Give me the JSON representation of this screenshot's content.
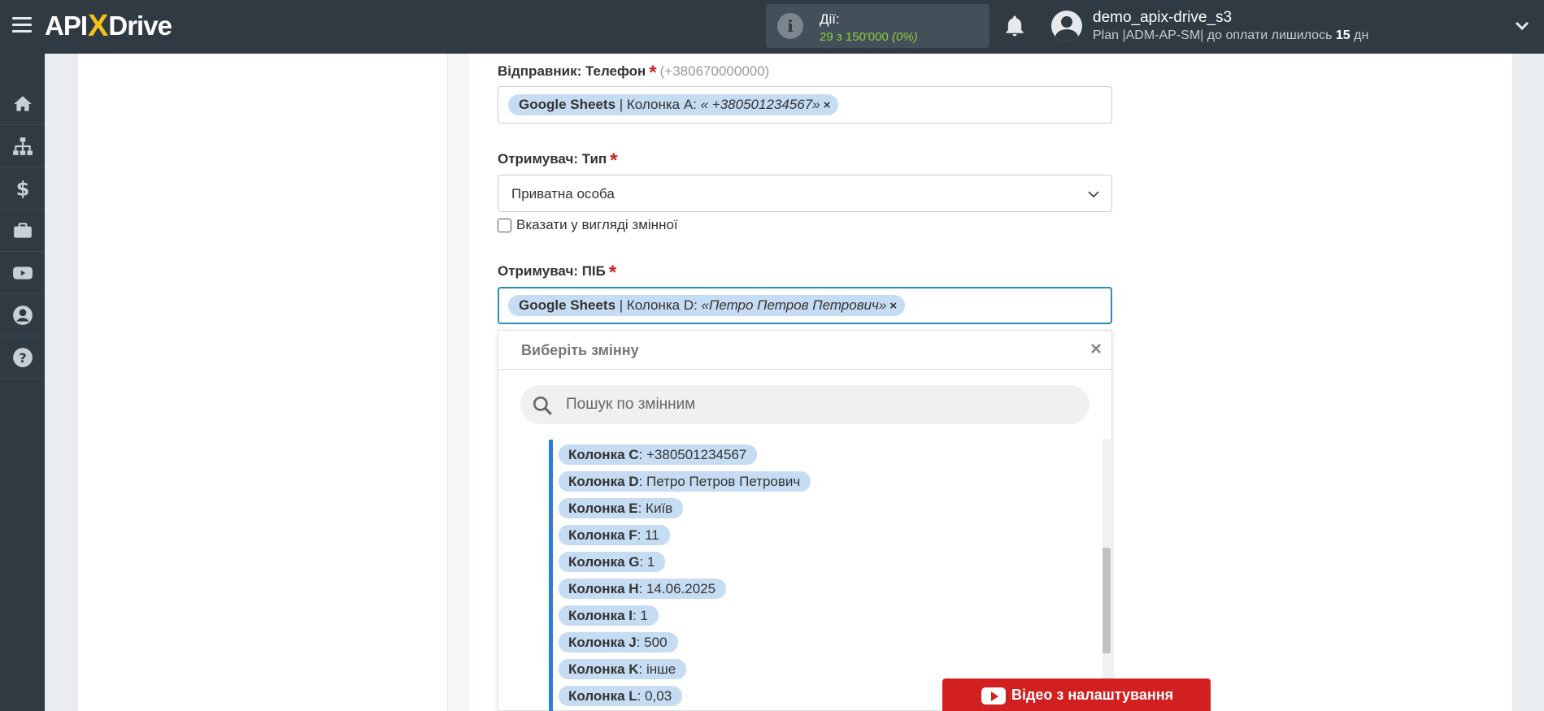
{
  "header": {
    "logo": {
      "api": "API",
      "x": "X",
      "drive": "Drive"
    },
    "actions_label": "Дії:",
    "actions_value": "29 з 150'000",
    "actions_percent": "(0%)",
    "user_name": "demo_apix-drive_s3",
    "user_plan_prefix": "Plan |ADM-AP-SM| до оплати лишилось",
    "user_plan_days": "15",
    "user_plan_suffix": "дн"
  },
  "sidebar": {
    "items": [
      {
        "icon": "home-icon"
      },
      {
        "icon": "sitemap-icon"
      },
      {
        "icon": "dollar-icon"
      },
      {
        "icon": "briefcase-icon"
      },
      {
        "icon": "youtube-icon"
      },
      {
        "icon": "user-icon"
      },
      {
        "icon": "help-icon"
      }
    ]
  },
  "form": {
    "sender_phone": {
      "label": "Відправник: Телефон",
      "required": "*",
      "hint": "(+380670000000)",
      "tag_source": "Google Sheets",
      "tag_column": " | Колонка A: ",
      "tag_value": "« +380501234567»",
      "tag_remove": "×"
    },
    "recipient_type": {
      "label": "Отримувач: Тип",
      "required": "*",
      "value": "Приватна особа",
      "checkbox_label": "Вказати у вигляді змінної"
    },
    "recipient_name": {
      "label": "Отримувач: ПІБ",
      "required": "*",
      "tag_source": "Google Sheets",
      "tag_column": " | Колонка D: ",
      "tag_value": "«Петро Петров Петрович»",
      "tag_remove": "×"
    }
  },
  "dropdown": {
    "title": "Виберіть змінну",
    "close": "×",
    "search_placeholder": "Пошук по змінним",
    "variables": [
      {
        "key": "Колонка C",
        "value": ": +380501234567"
      },
      {
        "key": "Колонка D",
        "value": ": Петро Петров Петрович"
      },
      {
        "key": "Колонка E",
        "value": ": Київ"
      },
      {
        "key": "Колонка F",
        "value": ": 11"
      },
      {
        "key": "Колонка G",
        "value": ": 1"
      },
      {
        "key": "Колонка H",
        "value": ": 14.06.2025"
      },
      {
        "key": "Колонка I",
        "value": ": 1"
      },
      {
        "key": "Колонка J",
        "value": ": 500"
      },
      {
        "key": "Колонка K",
        "value": ": інше"
      },
      {
        "key": "Колонка L",
        "value": ": 0,03"
      }
    ]
  },
  "video_button": {
    "label": "Відео з налаштування"
  },
  "colors": {
    "topbar": "#2f3a43",
    "accent_yellow": "#f6c21a",
    "actions_green": "#8fce3e",
    "tag_blue": "#c6dcf2",
    "required_red": "#d0202a",
    "video_red": "#d21f1f",
    "list_border": "#2a7fd4"
  }
}
